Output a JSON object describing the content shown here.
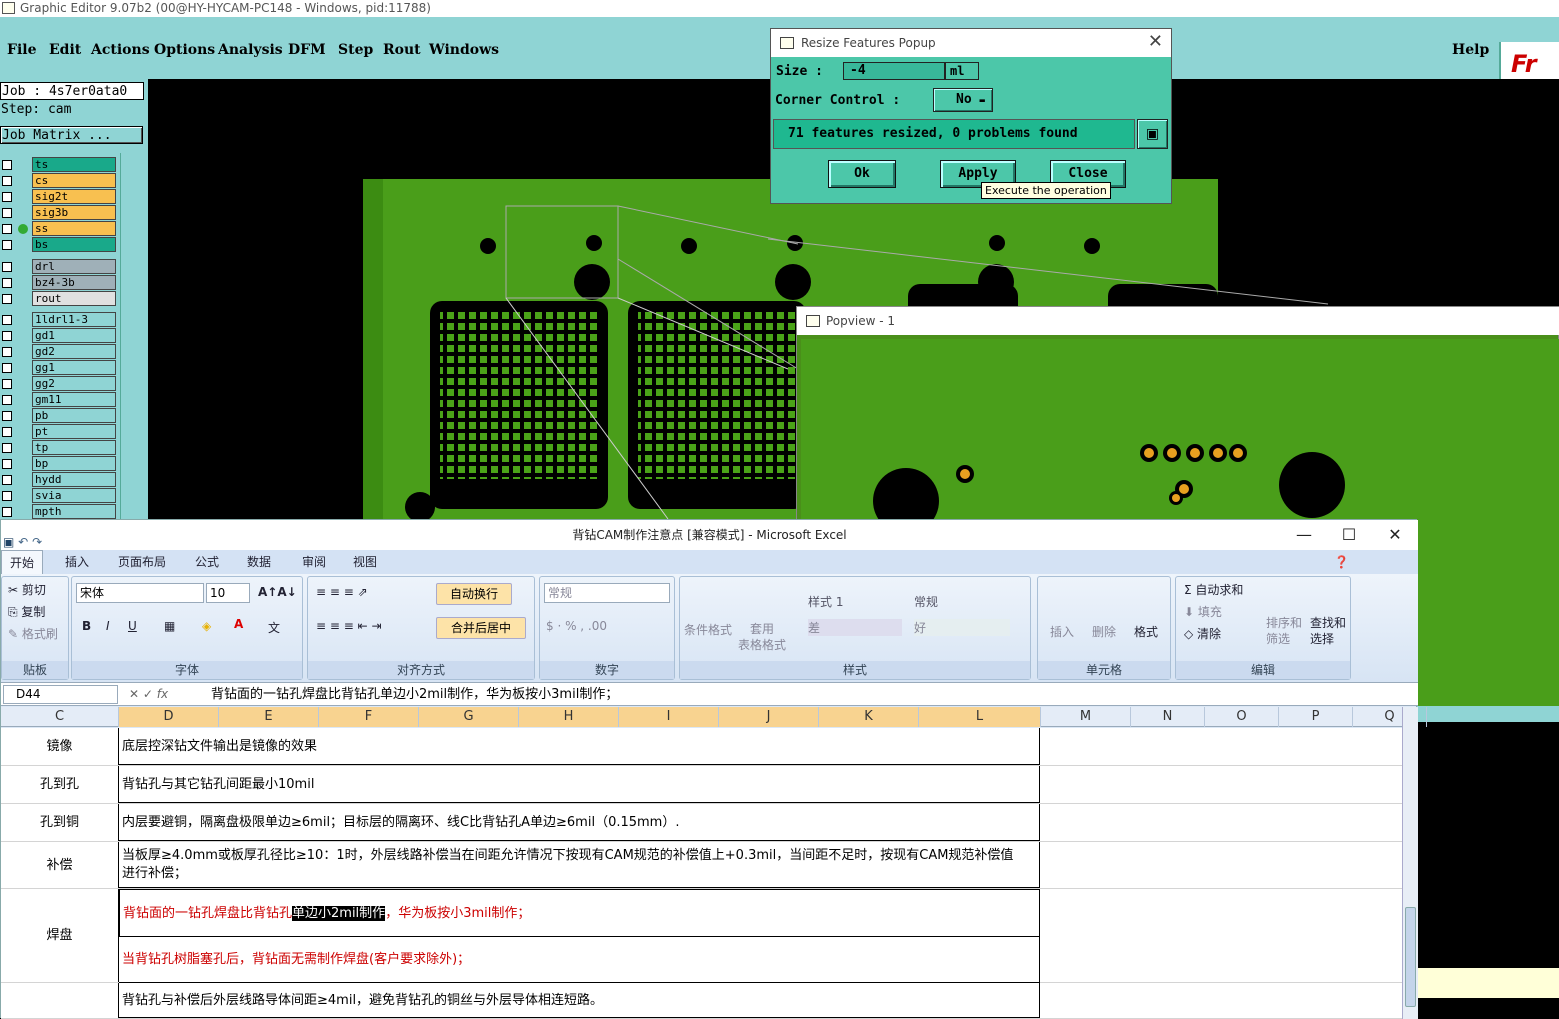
{
  "app": {
    "title": "Graphic Editor 9.07b2 (00@HY-HYCAM-PC148 - Windows, pid:11788)"
  },
  "menu": {
    "items": [
      "File",
      "Edit",
      "Actions",
      "Options",
      "Analysis",
      "DFM",
      "Step",
      "Rout",
      "Windows"
    ],
    "help": "Help",
    "logo": "Fr"
  },
  "job": {
    "job_line": "Job : 4s7er0ata0",
    "step_line": "Step: cam",
    "matrix_button": "Job Matrix ..."
  },
  "layers": [
    {
      "name": "ts",
      "color": "#19a98a"
    },
    {
      "name": "cs",
      "color": "#f8c050"
    },
    {
      "name": "sig2t",
      "color": "#f8c050"
    },
    {
      "name": "sig3b",
      "color": "#f8c050"
    },
    {
      "name": "ss",
      "color": "#f8c050"
    },
    {
      "name": "bs",
      "color": "#19a98a"
    },
    {
      "name": "drl",
      "color": "#9fb0b8"
    },
    {
      "name": "bz4-3b",
      "color": "#9fb0b8"
    },
    {
      "name": "rout",
      "color": "#e0e0e0"
    },
    {
      "name": "1ldrl1-3",
      "color": "#8fd4d4"
    },
    {
      "name": "gd1",
      "color": "#8fd4d4"
    },
    {
      "name": "gd2",
      "color": "#8fd4d4"
    },
    {
      "name": "gg1",
      "color": "#8fd4d4"
    },
    {
      "name": "gg2",
      "color": "#8fd4d4"
    },
    {
      "name": "gm11",
      "color": "#8fd4d4"
    },
    {
      "name": "pb",
      "color": "#8fd4d4"
    },
    {
      "name": "pt",
      "color": "#8fd4d4"
    },
    {
      "name": "tp",
      "color": "#8fd4d4"
    },
    {
      "name": "bp",
      "color": "#8fd4d4"
    },
    {
      "name": "hydd",
      "color": "#8fd4d4"
    },
    {
      "name": "svia",
      "color": "#8fd4d4"
    },
    {
      "name": "mpth",
      "color": "#8fd4d4"
    }
  ],
  "resize_popup": {
    "title": "Resize Features Popup",
    "size_label": "Size :",
    "size_value": "-4",
    "size_unit": "ml",
    "corner_label": "Corner Control :",
    "corner_value": "No",
    "status": "71 features resized, 0 problems found",
    "ok": "Ok",
    "apply": "Apply",
    "close": "Close",
    "tooltip": "Execute the operation"
  },
  "popview": {
    "title": "Popview - 1"
  },
  "excel": {
    "title": "背钻CAM制作注意点 [兼容模式] - Microsoft Excel",
    "tabs": [
      "开始",
      "插入",
      "页面布局",
      "公式",
      "数据",
      "审阅",
      "视图"
    ],
    "clipboard": {
      "cut": "剪切",
      "copy": "复制",
      "format_painter": "格式刷",
      "label": "贴板"
    },
    "font": {
      "name": "宋体",
      "size": "10",
      "label": "字体"
    },
    "alignment": {
      "wrap": "自动换行",
      "merge": "合并后居中",
      "label": "对齐方式"
    },
    "number": {
      "format": "常规",
      "label": "数字"
    },
    "styles": {
      "cond": "条件格式",
      "table": "套用\n表格格式",
      "style1": "样式 1",
      "normal": "常规",
      "bad": "差",
      "good": "好",
      "label": "样式"
    },
    "cells": {
      "insert": "插入",
      "delete": "删除",
      "format": "格式",
      "label": "单元格"
    },
    "editing": {
      "autosum": "自动求和",
      "fill": "填充",
      "clear": "清除",
      "sort": "排序和\n筛选",
      "find": "查找和\n选择",
      "label": "编辑"
    },
    "name_box": "D44",
    "formula": "背钻面的一钻孔焊盘比背钻孔单边小2mil制作，华为板按小3mil制作；",
    "columns": [
      "C",
      "D",
      "E",
      "F",
      "G",
      "H",
      "I",
      "J",
      "K",
      "L",
      "M",
      "N",
      "O",
      "P",
      "Q"
    ],
    "rows": [
      {
        "c": "镜像",
        "d": "底层控深钻文件输出是镜像的效果"
      },
      {
        "c": "孔到孔",
        "d": "背钻孔与其它钻孔间距最小10mil"
      },
      {
        "c": "孔到铜",
        "d": "内层要避铜，隔离盘极限单边≥6mil；目标层的隔离环、线C比背钻孔A单边≥6mil（0.15mm）."
      },
      {
        "c": "补偿",
        "d": "当板厚≥4.0mm或板厚孔径比≥10：1时，外层线路补偿当在间距允许情况下按现有CAM规范的补偿值上+0.3mil，当间距不足时，按现有CAM规范补偿值进行补偿；"
      },
      {
        "c": "焊盘",
        "d1_pre": "背钻面的一钻孔焊盘比背钻孔",
        "d1_hl": "单边小2mil制作",
        "d1_post": "，华为板按小3mil制作；",
        "d2": "当背钻孔树脂塞孔后，背钻面无需制作焊盘(客户要求除外)；"
      },
      {
        "c": "",
        "d": "背钻孔与补偿后外层线路导体间距≥4mil，避免背钻孔的铜丝与外层导体相连短路。"
      }
    ]
  }
}
